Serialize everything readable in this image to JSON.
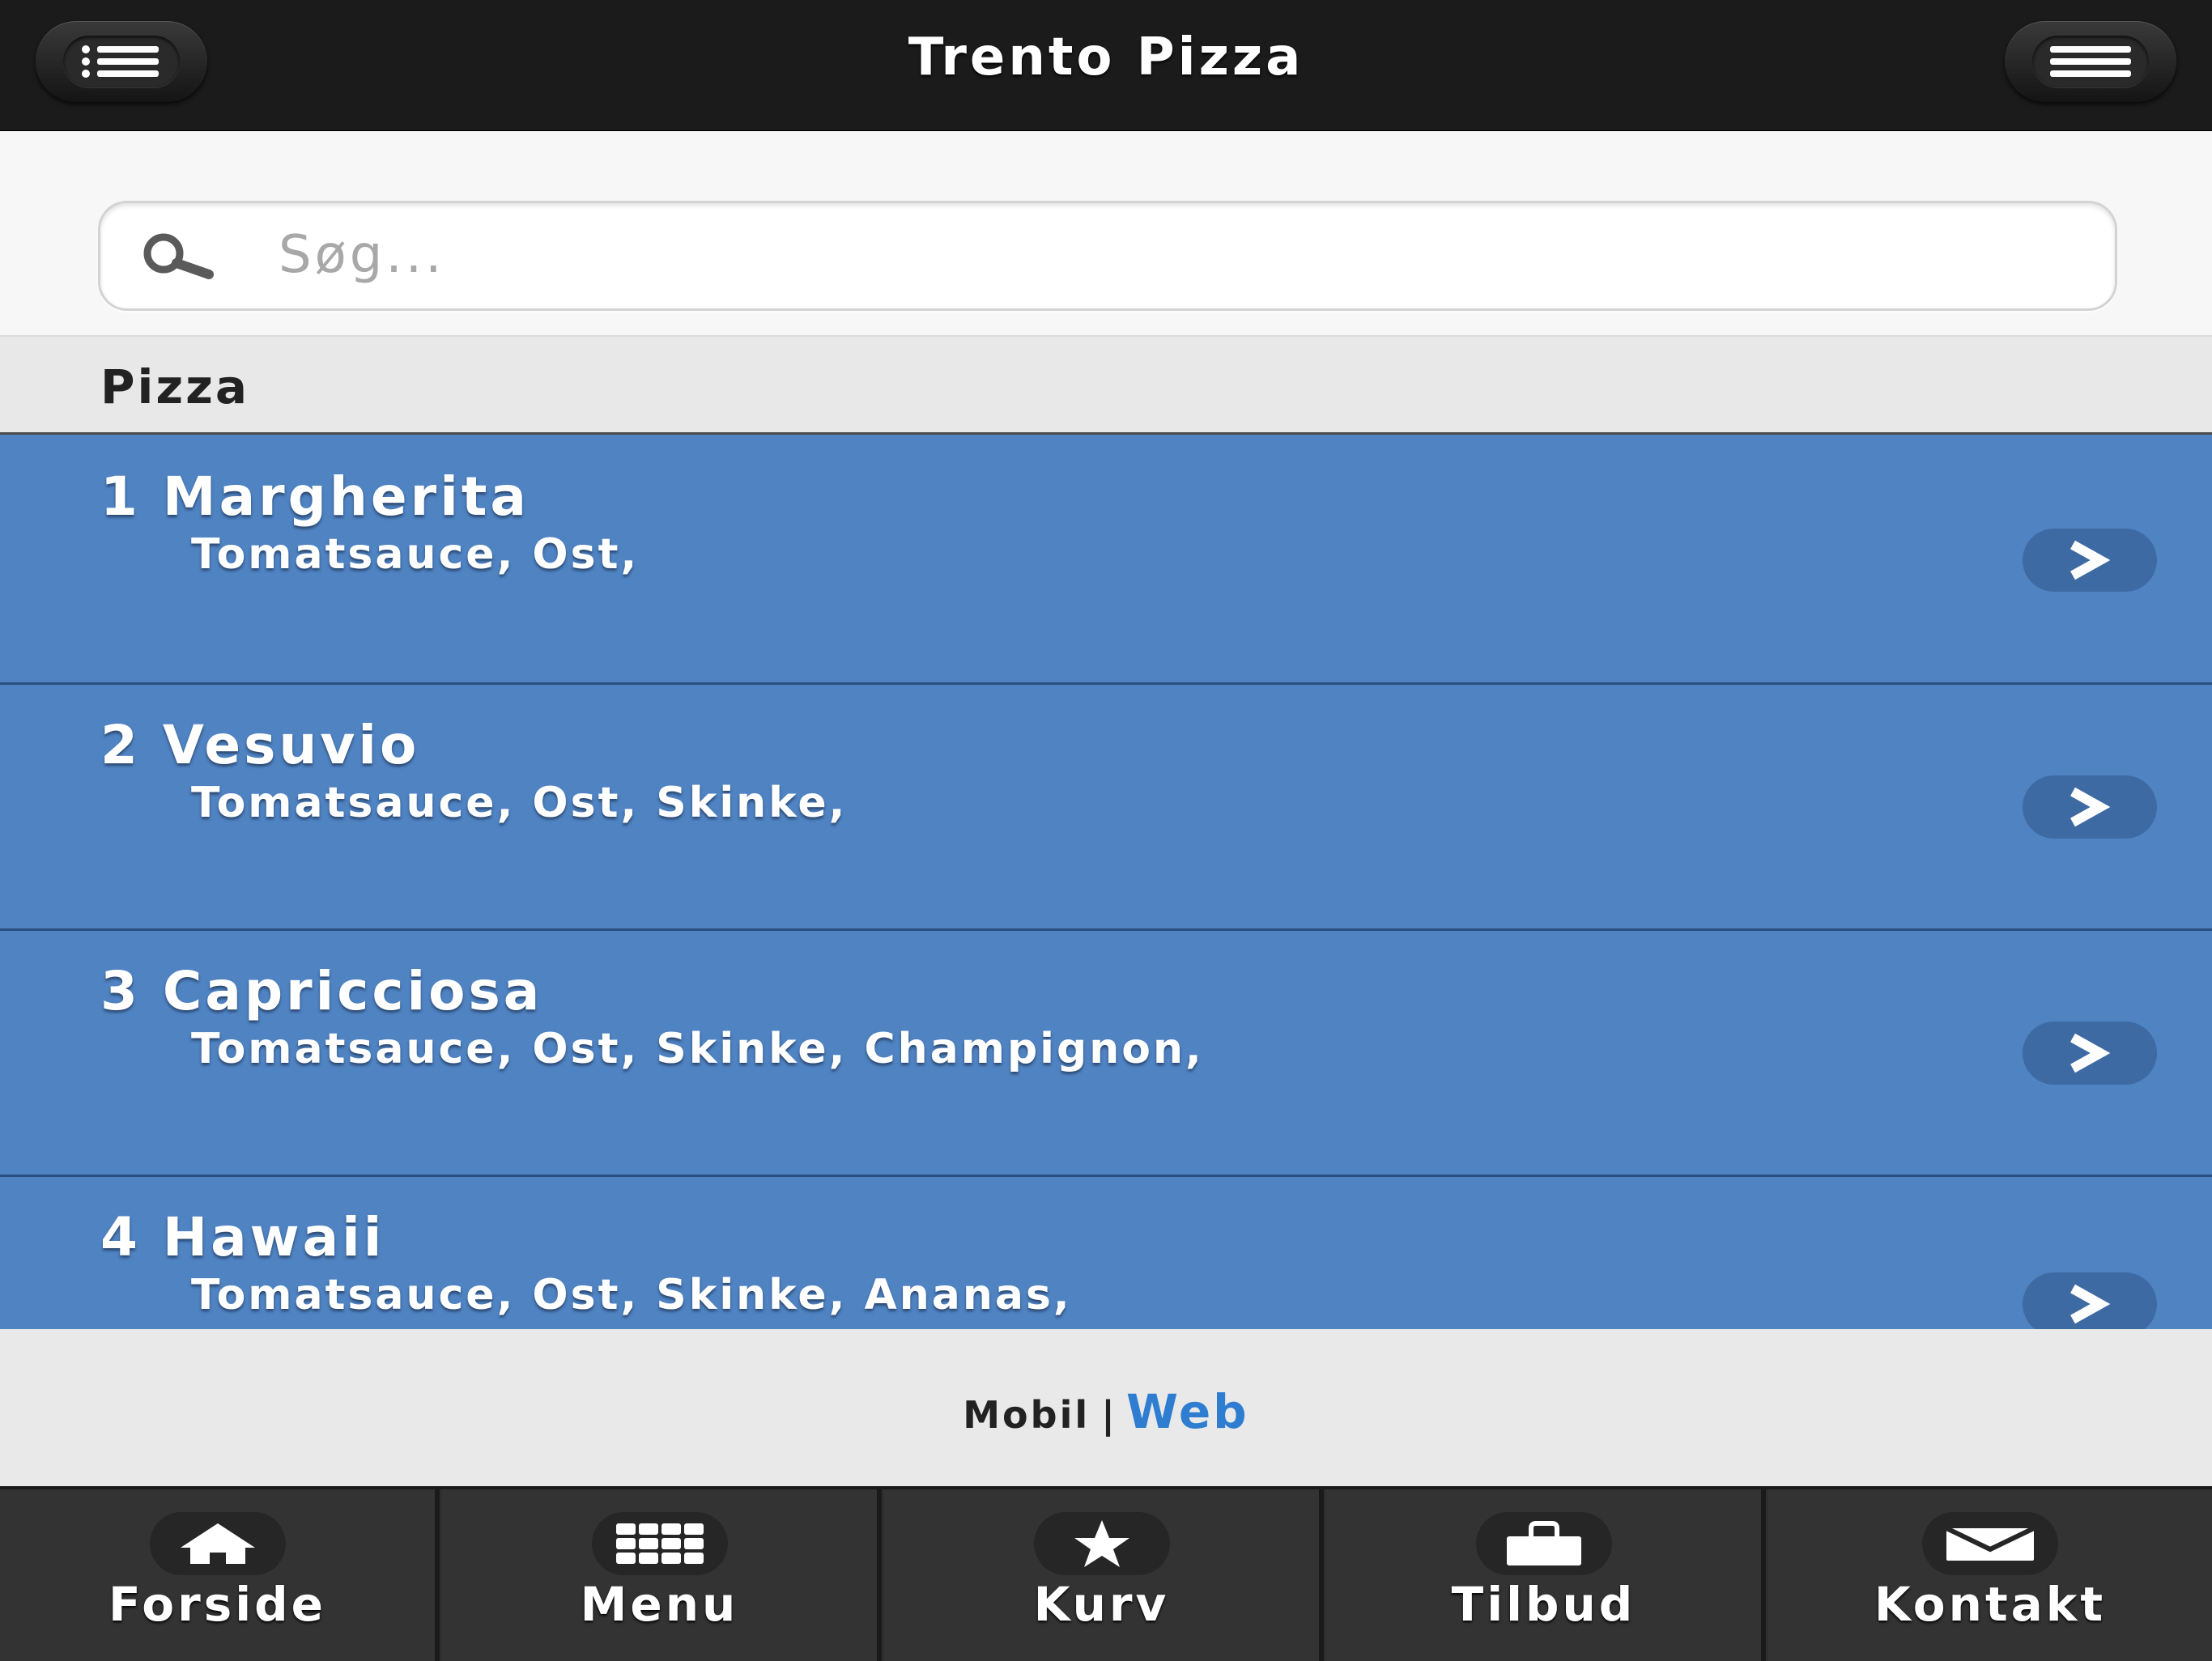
{
  "header": {
    "title": "Trento Pizza",
    "left_button_icon": "list-icon",
    "right_button_icon": "hamburger-menu-icon"
  },
  "search": {
    "placeholder": "Søg...",
    "value": ""
  },
  "category": {
    "label": "Pizza"
  },
  "items": [
    {
      "title": "1 Margherita",
      "description": "Tomatsauce, Ost,"
    },
    {
      "title": "2 Vesuvio",
      "description": "Tomatsauce, Ost, Skinke,"
    },
    {
      "title": "3 Capricciosa",
      "description": "Tomatsauce, Ost, Skinke, Champignon,"
    },
    {
      "title": "4 Hawaii",
      "description": "Tomatsauce, Ost, Skinke, Ananas,"
    }
  ],
  "footer": {
    "mobile": "Mobil",
    "separator": "|",
    "web": "Web"
  },
  "nav": [
    {
      "label": "Forside",
      "icon": "home-icon"
    },
    {
      "label": "Menu",
      "icon": "grid-icon"
    },
    {
      "label": "Kurv",
      "icon": "star-icon"
    },
    {
      "label": "Tilbud",
      "icon": "bag-icon"
    },
    {
      "label": "Kontakt",
      "icon": "envelope-icon"
    }
  ],
  "colors": {
    "header_bg": "#1b1b1b",
    "list_item_bg": "#4f83c2",
    "link_blue": "#2f7dd1",
    "nav_bg": "#333333"
  }
}
